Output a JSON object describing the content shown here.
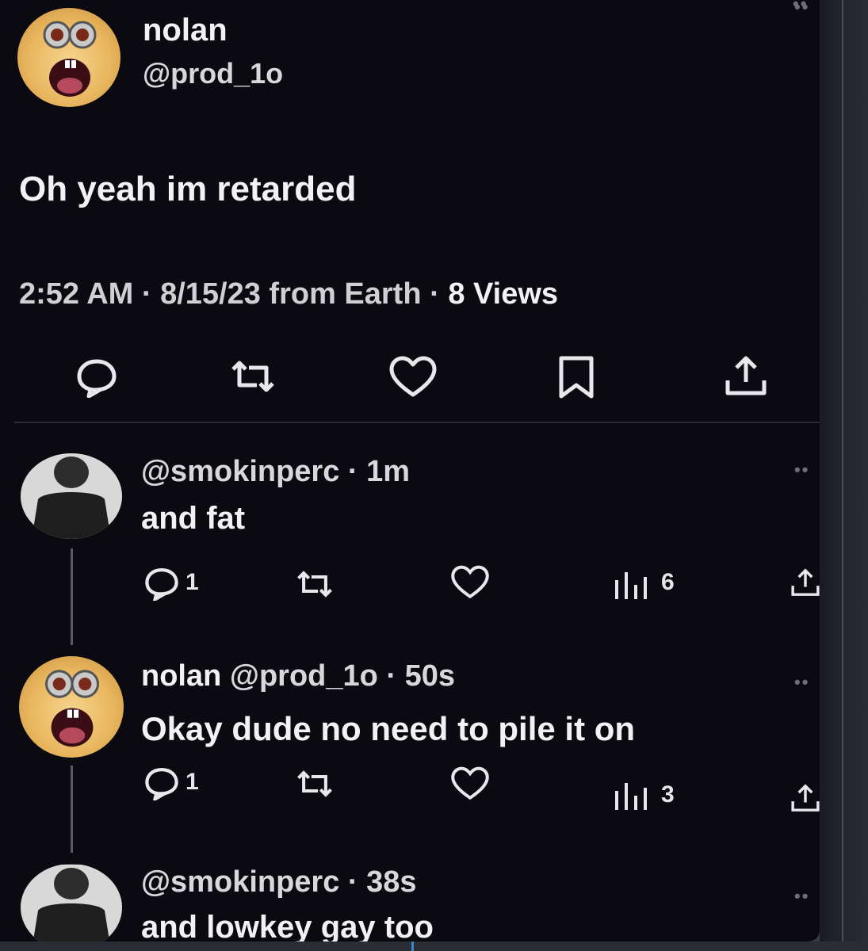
{
  "main_tweet": {
    "display_name": "nolan",
    "handle": "@prod_1o",
    "text": "Oh yeah im retarded",
    "meta": "2:52 AM · 8/15/23 from Earth · ",
    "views_count": "8",
    "views_label": " Views"
  },
  "replies": [
    {
      "header": "@smokinperc · 1m",
      "text": "and fat",
      "reply_count": "1",
      "view_count": "6"
    },
    {
      "display_name": "nolan",
      "header": " @prod_1o · 50s",
      "text": "Okay dude no need to pile it on",
      "reply_count": "1",
      "view_count": "3"
    },
    {
      "header": "@smokinperc · 38s",
      "text": "and lowkey gay too"
    }
  ],
  "icons": {
    "reply": "speech-bubble-icon",
    "retweet": "retweet-icon",
    "like": "heart-icon",
    "bookmark": "bookmark-icon",
    "share": "share-icon",
    "views": "bar-chart-icon",
    "more": "more-dots-icon"
  },
  "colors": {
    "background": "#0b0a10",
    "text": "#f2f2f4",
    "muted": "#8a8a90"
  }
}
